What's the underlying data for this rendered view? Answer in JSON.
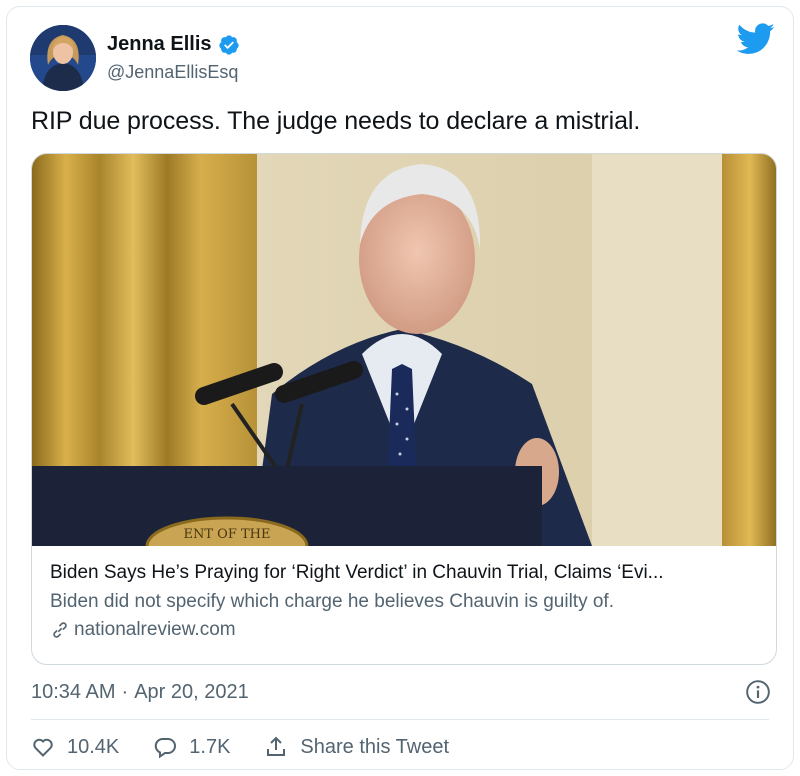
{
  "user": {
    "name": "Jenna Ellis",
    "handle": "@JennaEllisEsq"
  },
  "tweet": {
    "text": "RIP due process. The judge needs to declare a mistrial.",
    "time": "10:34 AM",
    "separator": "·",
    "date": "Apr 20, 2021"
  },
  "link_card": {
    "title": "Biden Says He’s Praying for ‘Right Verdict’ in Chauvin Trial, Claims ‘Evi...",
    "description": "Biden did not specify which charge he believes Chauvin is guilty of.",
    "domain": "nationalreview.com",
    "seal_text": "ENT OF THE"
  },
  "actions": {
    "likes": "10.4K",
    "replies": "1.7K",
    "share_label": "Share this Tweet"
  },
  "colors": {
    "twitter_blue": "#1d9bf0",
    "text_primary": "#0f1419",
    "text_secondary": "#536471",
    "border": "#cfd9de"
  },
  "icons": [
    "verified-badge-icon",
    "twitter-bird-icon",
    "link-icon",
    "info-icon",
    "heart-icon",
    "reply-icon",
    "share-icon"
  ]
}
